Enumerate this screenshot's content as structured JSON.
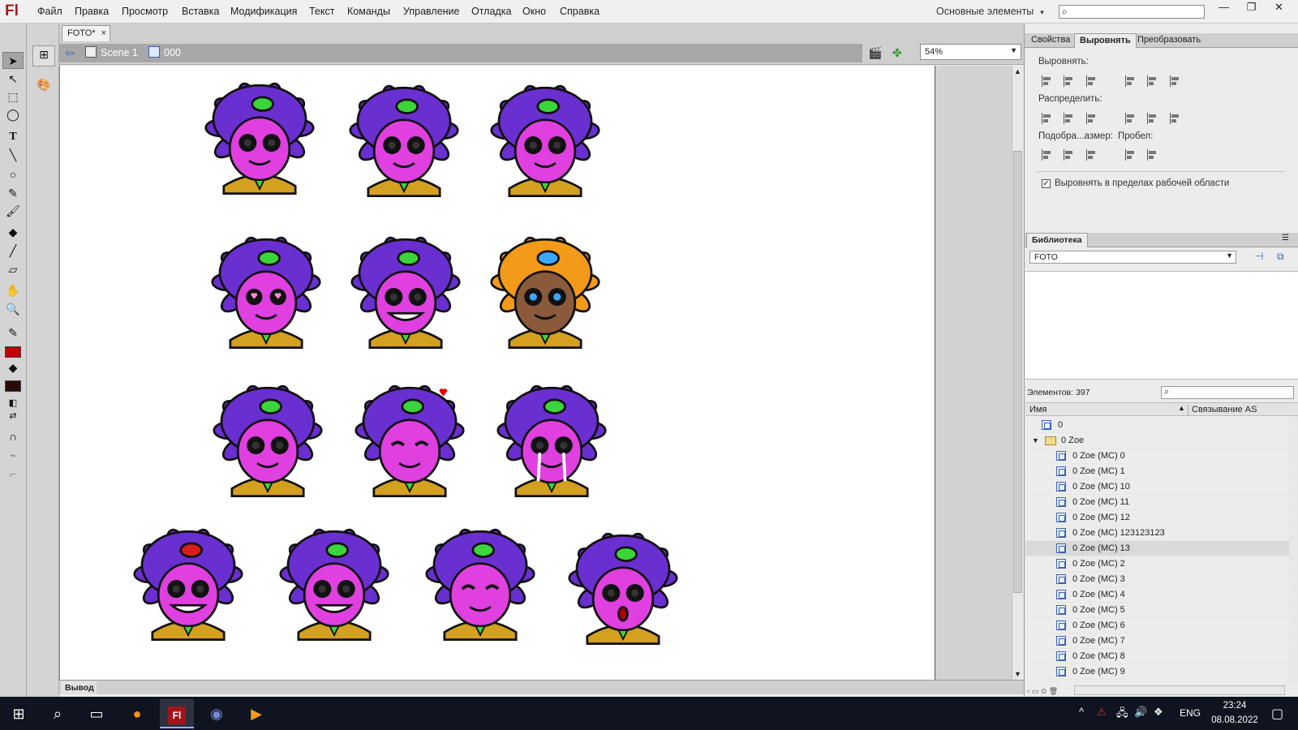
{
  "app": {
    "logo": "Fl"
  },
  "menu": [
    "Файл",
    "Правка",
    "Просмотр",
    "Вставка",
    "Модификация",
    "Текст",
    "Команды",
    "Управление",
    "Отладка",
    "Окно",
    "Справка"
  ],
  "workspace": {
    "label": "Основные элементы",
    "arrow": "▾"
  },
  "document": {
    "tab": "FOTO*",
    "close": "×",
    "scene": "Scene 1",
    "symbol": "000",
    "zoom": "54%"
  },
  "panels": {
    "tabs": [
      "Свойства",
      "Выровнять",
      "Преобразовать"
    ],
    "active_tab": "Выровнять",
    "align_label": "Выровнять:",
    "distribute_label": "Распределить:",
    "match_size_label": "Подобра...азмер:",
    "space_label": "Пробел:",
    "stage_checkbox": "Выровнять в пределах рабочей области",
    "stage_checked": true
  },
  "library": {
    "tab": "Библиотека",
    "file": "FOTO",
    "count_label": "Элементов: 397",
    "col_name": "Имя",
    "col_link": "Связывание AS",
    "items": [
      {
        "name": "0",
        "kind": "symbol",
        "indent": 0
      },
      {
        "name": "0 Zoe",
        "kind": "folder",
        "indent": 0
      },
      {
        "name": "0 Zoe (MC) 0",
        "kind": "symbol",
        "indent": 1
      },
      {
        "name": "0 Zoe (MC) 1",
        "kind": "symbol",
        "indent": 1
      },
      {
        "name": "0 Zoe (MC) 10",
        "kind": "symbol",
        "indent": 1
      },
      {
        "name": "0 Zoe (MC) 11",
        "kind": "symbol",
        "indent": 1
      },
      {
        "name": "0 Zoe (MC) 12",
        "kind": "symbol",
        "indent": 1
      },
      {
        "name": "0 Zoe (MC) 123123123",
        "kind": "symbol",
        "indent": 1
      },
      {
        "name": "0 Zoe (MC) 13",
        "kind": "symbol",
        "indent": 1,
        "selected": true
      },
      {
        "name": "0 Zoe (MC) 2",
        "kind": "symbol",
        "indent": 1
      },
      {
        "name": "0 Zoe (MC) 3",
        "kind": "symbol",
        "indent": 1
      },
      {
        "name": "0 Zoe (MC) 4",
        "kind": "symbol",
        "indent": 1
      },
      {
        "name": "0 Zoe (MC) 5",
        "kind": "symbol",
        "indent": 1
      },
      {
        "name": "0 Zoe (MC) 6",
        "kind": "symbol",
        "indent": 1
      },
      {
        "name": "0 Zoe (MC) 7",
        "kind": "symbol",
        "indent": 1
      },
      {
        "name": "0 Zoe (MC) 8",
        "kind": "symbol",
        "indent": 1
      },
      {
        "name": "0 Zoe (MC) 9",
        "kind": "symbol",
        "indent": 1
      }
    ]
  },
  "output": {
    "tab": "Вывод"
  },
  "taskbar": {
    "lang": "ENG",
    "time": "23:24",
    "date": "08.08.2022",
    "flash_label": "Fl"
  },
  "colors": {
    "hair_purple": "#6a2fd0",
    "hair_orange": "#f39a1a",
    "skin_pink": "#e040e0",
    "gem_green": "#3bd43b",
    "gem_red": "#d91c1c",
    "stroke_color": "#c00000",
    "fill_color": "#2a0a0a"
  },
  "expressions": [
    "smile",
    "grin",
    "blush",
    "heart-eyes",
    "wide-grin",
    "gold-variant",
    "drool",
    "hearts-closed-eyes",
    "crying",
    "angry-red-gem",
    "wink-open-mouth",
    "wink-smile",
    "surprised"
  ]
}
